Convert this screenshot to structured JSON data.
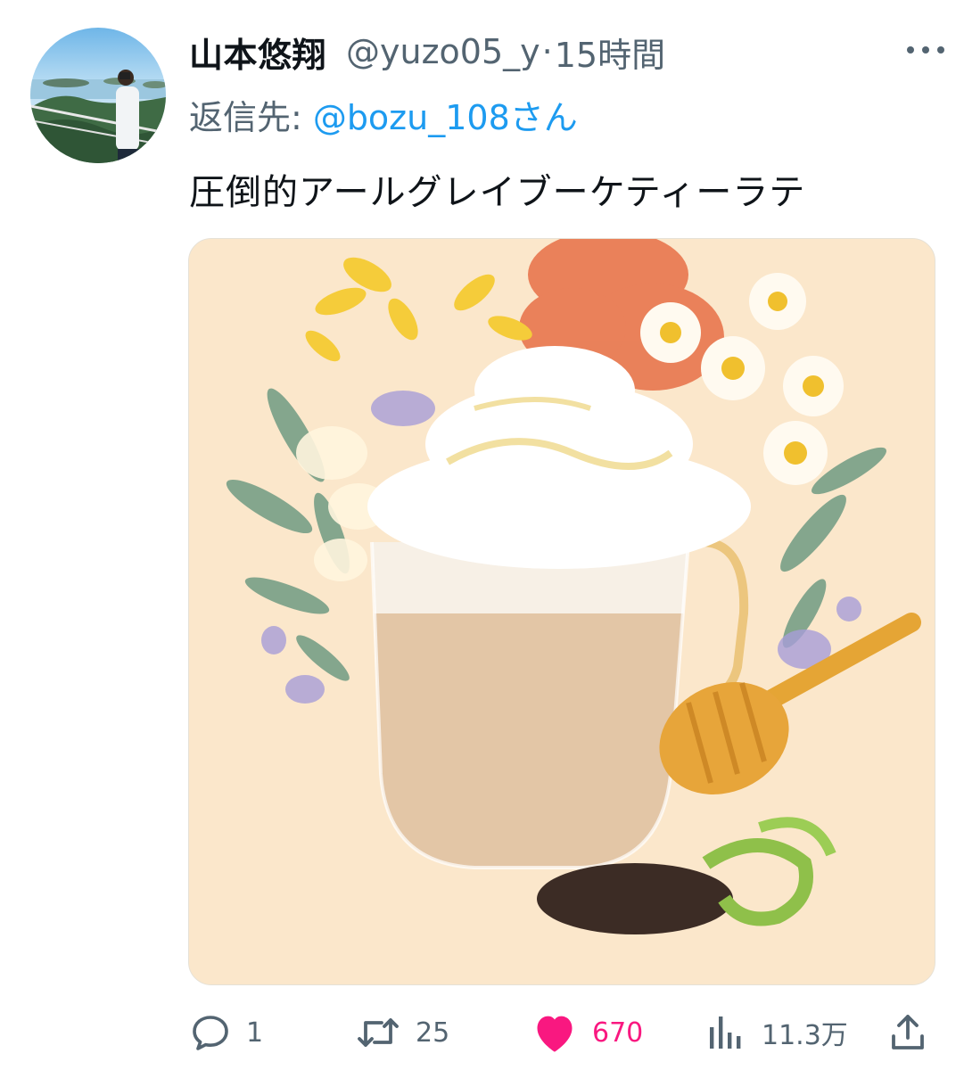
{
  "tweet": {
    "display_name": "山本悠翔",
    "handle": "@yuzo05_y",
    "separator": "·",
    "time_ago": "15時間",
    "reply_label": "返信先:",
    "reply_to": "@bozu_108さん",
    "text": "圧倒的アールグレイブーケティーラテ",
    "media_description": "ティーラテの商品写真",
    "more_icon": "more-horizontal-icon"
  },
  "actions": {
    "replies": {
      "icon": "reply-icon",
      "count": "1"
    },
    "retweets": {
      "icon": "retweet-icon",
      "count": "25"
    },
    "likes": {
      "icon": "heart-icon",
      "count": "670",
      "color": "#f91880"
    },
    "views": {
      "icon": "views-icon",
      "count": "11.3万"
    },
    "share": {
      "icon": "share-icon"
    }
  },
  "colors": {
    "text_primary": "#0f1419",
    "text_secondary": "#536471",
    "link": "#1d9bf0",
    "like": "#f91880",
    "media_background": "#fbe7cb"
  }
}
